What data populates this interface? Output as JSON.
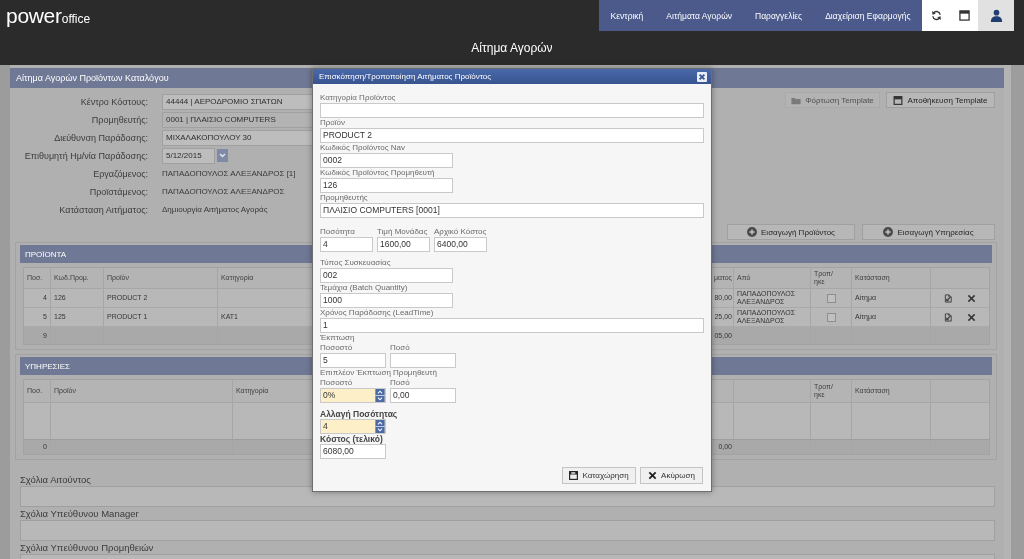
{
  "header": {
    "logo": {
      "main": "power",
      "sub": "office"
    },
    "nav": [
      {
        "label": "Κεντρική",
        "selected": false
      },
      {
        "label": "Αιτήματα Αγορών",
        "selected": false
      },
      {
        "label": "Παραγγελίες",
        "selected": false
      },
      {
        "label": "Διαχείριση Εφαρμογής",
        "selected": false
      }
    ],
    "page_title": "Αίτημα Αγορών"
  },
  "request": {
    "title": "Αίτημα Αγορών Προϊόντων Καταλόγου",
    "fields": [
      {
        "kind": "input",
        "label": "Κέντρο Κόστους:",
        "value": "44444 | ΑΕΡΟΔΡΟΜΙΟ ΣΠΑΤΩΝ"
      },
      {
        "kind": "locked",
        "label": "Προμηθευτής:",
        "value": "0001 | ΠΛΑΙΣΙΟ COMPUTERS"
      },
      {
        "kind": "input",
        "label": "Διεύθυνση Παράδοσης:",
        "value": "ΜΙΧΑΛΑΚΟΠΟΥΛΟΥ 30"
      },
      {
        "kind": "date",
        "label": "Επιθυμητή Ημ/νία Παράδοσης:",
        "value": "5/12/2015"
      },
      {
        "kind": "text",
        "label": "Εργαζόμενος:",
        "value": "ΠΑΠΑΔΟΠΟΥΛΟΣ ΑΛΕΞΑΝΔΡΟΣ [1]"
      },
      {
        "kind": "text",
        "label": "Προϊστάμενος:",
        "value": "ΠΑΠΑΔΟΠΟΥΛΟΣ ΑΛΕΞΑΝΔΡΟΣ"
      },
      {
        "kind": "text",
        "label": "Κατάσταση Αιτήματος:",
        "value": "Δημιουργία Αιτήματος Αγοράς"
      }
    ],
    "template_buttons": [
      {
        "kind": "load",
        "label": "Φόρτωση Template",
        "disabled": true
      },
      {
        "kind": "save",
        "label": "Αποθήκευση Template",
        "disabled": false
      }
    ],
    "add_buttons": [
      {
        "label": "Εισαγωγή Προϊόντος"
      },
      {
        "label": "Εισαγωγή Υπηρεσίας"
      }
    ]
  },
  "products": {
    "title": "ΠΡΟΪΟΝΤΑ",
    "columns": [
      "Ποσ.",
      "Κωδ.Προμ.",
      "Προϊόν",
      "Κατηγορία",
      "ματος",
      "Από",
      "Τροπ/ ηκε",
      "Κατάσταση"
    ],
    "rows": [
      {
        "qty": "4",
        "supplier_code": "126",
        "product": "PRODUCT 2",
        "column_5": "80,00",
        "from": "ΠΑΠΑΔΟΠΟΥΛΟΣ ΑΛΕΞΑΝΔΡΟΣ",
        "modified": false,
        "status": "Αίτημα"
      },
      {
        "qty": "5",
        "supplier_code": "125",
        "product": "PRODUCT 1",
        "category": "KAT1",
        "column_5": "25,00",
        "from": "ΠΑΠΑΔΟΠΟΥΛΟΣ ΑΛΕΞΑΝΔΡΟΣ",
        "modified": false,
        "status": "Αίτημα"
      }
    ],
    "footer": {
      "qty": "9",
      "column_5": "05,00"
    }
  },
  "services": {
    "title": "ΥΠΗΡΕΣΙΕΣ",
    "columns": [
      "Ποσ.",
      "Προϊόν",
      "Κατηγορία",
      "Τροπ/ ηκε",
      "Κατάσταση"
    ],
    "footer": {
      "qty": "0",
      "column_4": "0,00"
    }
  },
  "comments": [
    {
      "label": "Σχόλια Αιτούντος"
    },
    {
      "label": "Σχόλια Υπεύθυνου Manager"
    },
    {
      "label": "Σχόλια Υπεύθυνου Προμηθειών"
    }
  ],
  "modal": {
    "title": "Επισκόπηση/Τροποποίηση Αιτήματος Προϊόντος",
    "rows": [
      {
        "strong": false,
        "fields": [
          {
            "kind": "text",
            "label": "Κατηγορία Προϊόντος"
          }
        ]
      },
      {
        "strong": false,
        "fields": [
          {
            "kind": "text",
            "label": "Προϊόν",
            "value": "PRODUCT 2"
          }
        ]
      },
      {
        "strong": false,
        "fields": [
          {
            "kind": "text",
            "label": "Κωδικός Προϊόντος Nav",
            "value": "0002"
          }
        ]
      },
      {
        "strong": false,
        "fields": [
          {
            "kind": "text",
            "label": "Κωδικός Προϊόντος Προμηθευτή",
            "value": "126"
          }
        ]
      },
      {
        "strong": false,
        "fields": [
          {
            "kind": "text",
            "label": "Προμηθευτής",
            "value": "ΠΛΑΙΣΙΟ COMPUTERS [0001]"
          }
        ]
      },
      {
        "strong": false,
        "fields": [
          {
            "kind": "text",
            "label": "Ποσότητα",
            "value": "4"
          },
          {
            "kind": "text",
            "label": "Τιμή Μονάδας",
            "value": "1600,00"
          },
          {
            "kind": "text",
            "label": "Αρχικό Κόστος",
            "value": "6400,00"
          }
        ]
      },
      {
        "strong": false,
        "fields": [
          {
            "kind": "text",
            "label": "Τύπος Συσκευασίας",
            "value": "002"
          }
        ]
      },
      {
        "strong": false,
        "fields": [
          {
            "kind": "text",
            "label": "Τεμάχια (Batch Quantity)",
            "value": "1000"
          }
        ]
      },
      {
        "strong": false,
        "fields": [
          {
            "kind": "text",
            "label": "Χρόνος Παράδοσης (LeadTime)",
            "value": "1"
          }
        ]
      },
      {
        "strong": false,
        "heading": "Έκπτωση",
        "fields": [
          {
            "kind": "text",
            "label": "Ποσοστό",
            "value": "5"
          },
          {
            "kind": "text",
            "label": "Ποσό"
          }
        ]
      },
      {
        "strong": false,
        "heading": "Επιπλέον Έκπτωση Προμηθευτή",
        "fields": [
          {
            "kind": "spinner",
            "label": "Ποσοστό",
            "value": "0%"
          },
          {
            "kind": "text",
            "label": "Ποσό",
            "value": "0,00"
          }
        ]
      },
      {
        "strong": true,
        "fields": [
          {
            "kind": "spinner",
            "label": "Αλλαγή Ποσότητας",
            "value": "4"
          }
        ]
      },
      {
        "strong": true,
        "fields": [
          {
            "kind": "text",
            "label": "Κόστος (τελικό)",
            "value": "6080,00"
          }
        ]
      }
    ],
    "buttons": [
      {
        "kind": "save",
        "label": "Καταχώρηση"
      },
      {
        "kind": "cancel",
        "label": "Ακύρωση"
      }
    ]
  }
}
